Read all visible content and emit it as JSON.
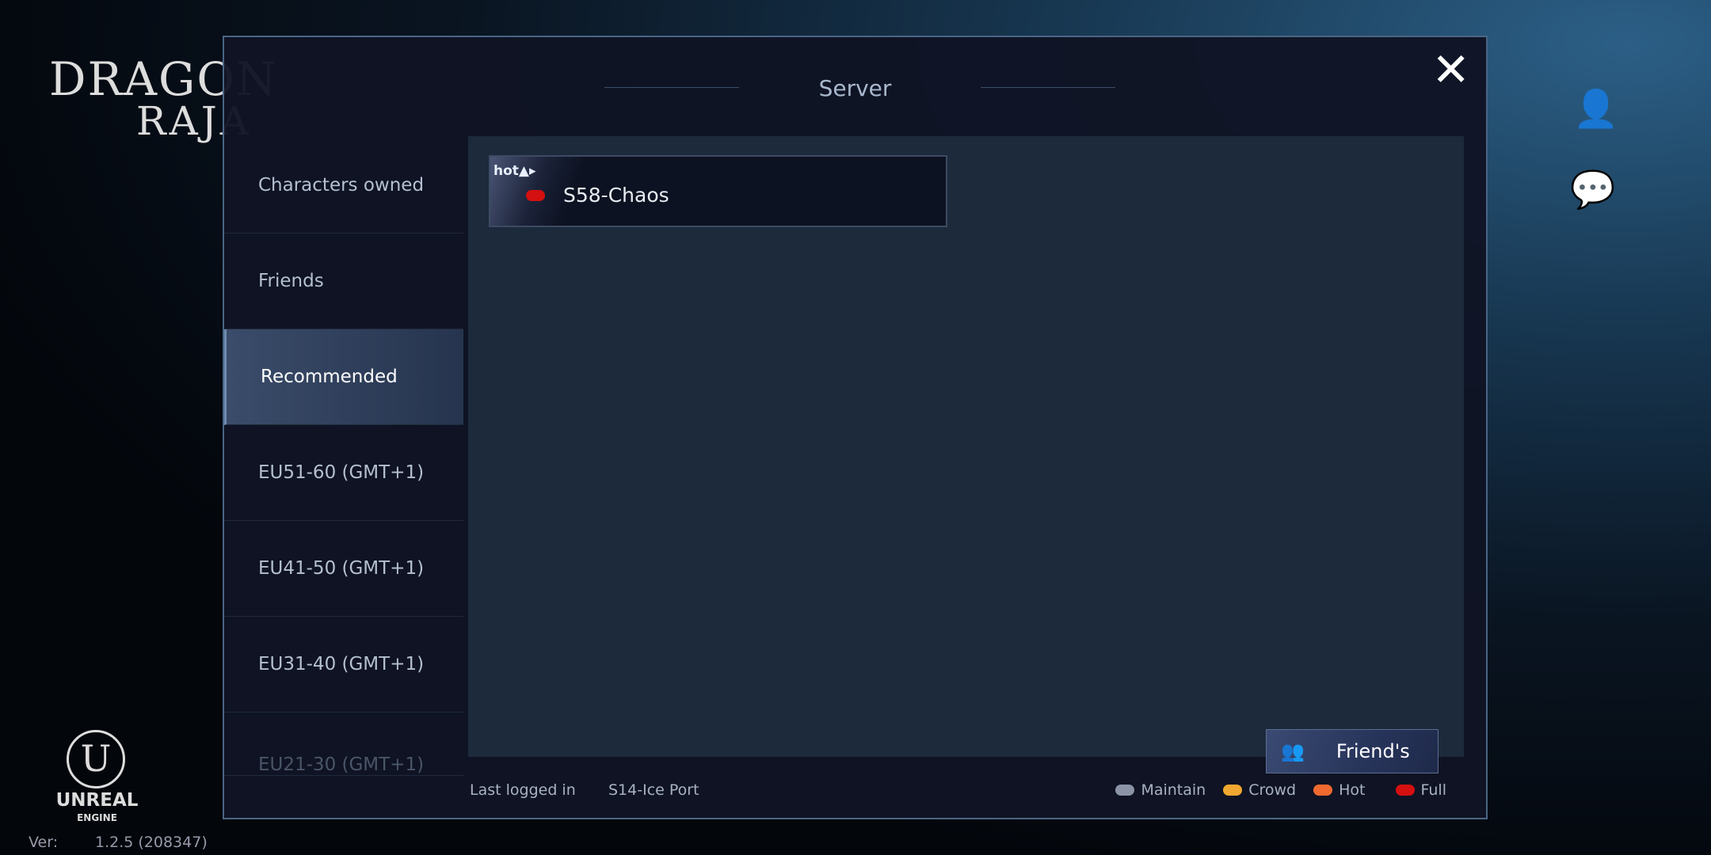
{
  "logo": {
    "line1": "DRAGON",
    "line2": "RAJA"
  },
  "modal": {
    "title": "Server",
    "close_icon": "close-icon"
  },
  "sidebar": {
    "items": [
      {
        "label": "Characters owned"
      },
      {
        "label": "Friends"
      },
      {
        "label": "Recommended",
        "active": true
      },
      {
        "label": "EU51-60 (GMT+1)"
      },
      {
        "label": "EU41-50 (GMT+1)"
      },
      {
        "label": "EU31-40 (GMT+1)"
      },
      {
        "label": "EU21-30 (GMT+1)"
      }
    ]
  },
  "servers": [
    {
      "badge": "hot▲▸",
      "name": "S58-Chaos",
      "status": "Full",
      "status_color": "#d41010"
    }
  ],
  "friends_button": {
    "label": "Friend's",
    "icon": "friends-icon"
  },
  "footer": {
    "last_logged_label": "Last logged in",
    "last_logged_server": "S14-Ice Port"
  },
  "legend": [
    {
      "label": "Maintain",
      "color": "#8a94a6"
    },
    {
      "label": "Crowd",
      "color": "#f0a830"
    },
    {
      "label": "Hot",
      "color": "#f06a30"
    },
    {
      "label": "Full",
      "color": "#d41010"
    }
  ],
  "right_icons": [
    "switch-account-icon",
    "chat-icon"
  ],
  "engine": {
    "name": "UNREAL",
    "sub": "ENGINE"
  },
  "version": {
    "label": "Ver:",
    "value": "1.2.5 (208347)"
  }
}
